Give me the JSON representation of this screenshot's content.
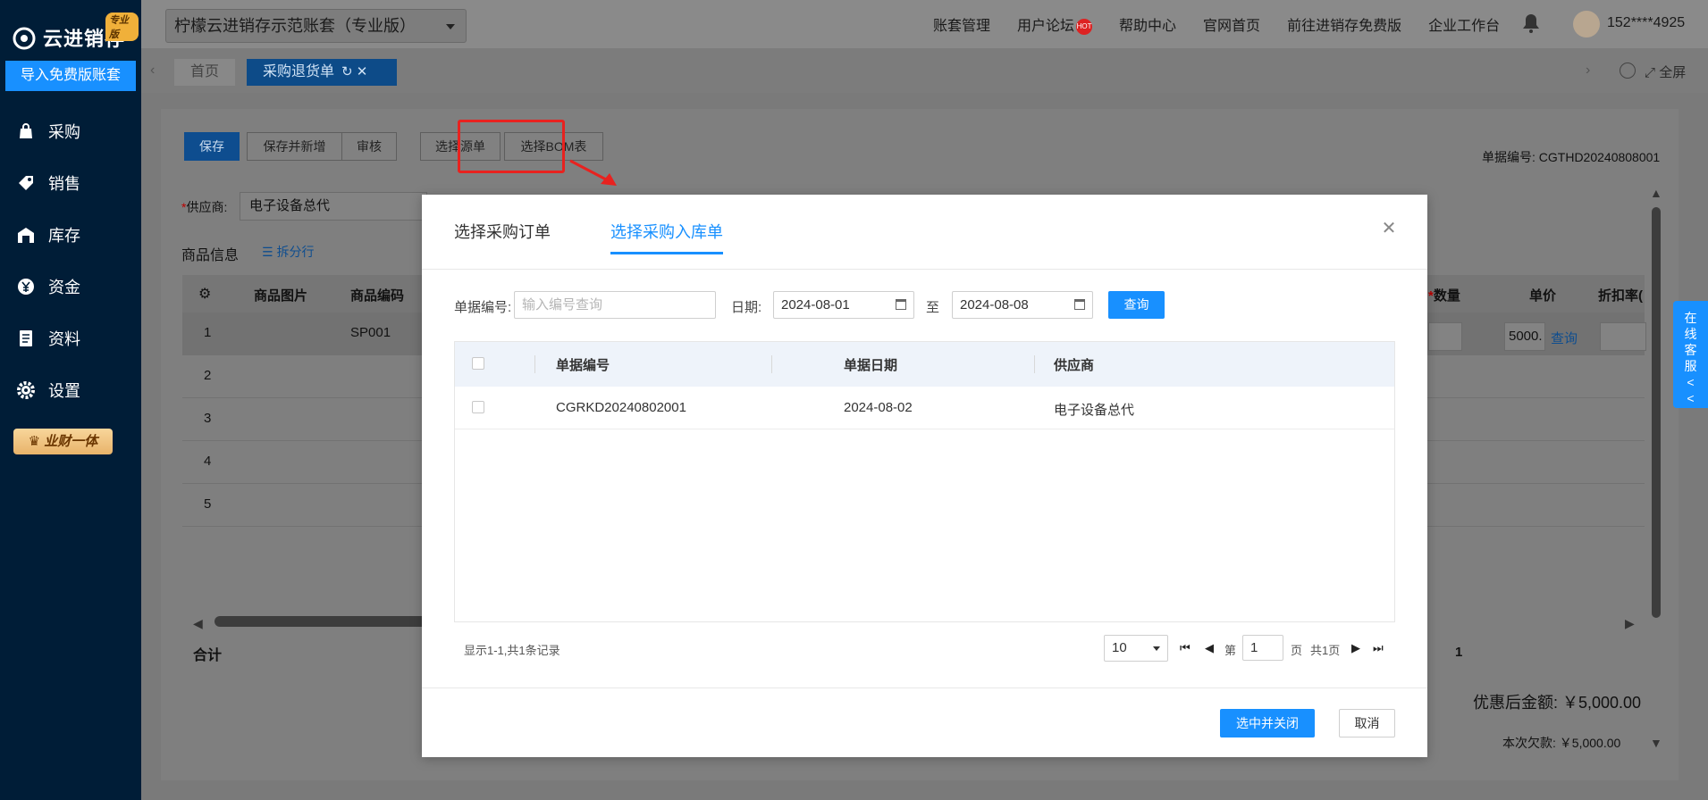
{
  "sidebar": {
    "logo_text": "云进销存",
    "logo_badge": "专业版",
    "import_button": "导入免费版账套",
    "items": [
      {
        "label": "采购",
        "icon": "bag-icon"
      },
      {
        "label": "销售",
        "icon": "sales-icon"
      },
      {
        "label": "库存",
        "icon": "warehouse-icon"
      },
      {
        "label": "资金",
        "icon": "yen-icon"
      },
      {
        "label": "资料",
        "icon": "document-icon"
      },
      {
        "label": "设置",
        "icon": "gear-icon"
      }
    ],
    "vip_badge": "业财一体"
  },
  "topbar": {
    "account": "柠檬云进销存示范账套（专业版）",
    "links": [
      "账套管理",
      "用户论坛",
      "帮助中心",
      "官网首页",
      "前往进销存免费版",
      "企业工作台"
    ],
    "hot_badge": "HOT",
    "user_phone": "152****4925"
  },
  "tabs": {
    "home": "首页",
    "active": "采购退货单",
    "fullscreen": "全屏"
  },
  "page": {
    "toolbar": [
      "保存",
      "保存并新增",
      "审核",
      "选择源单",
      "选择BOM表"
    ],
    "doc_no": "单据编号: CGTHD20240808001",
    "supplier_label": "供应商:",
    "supplier_value": "电子设备总代",
    "goods_title": "商品信息",
    "split_row": "拆分行",
    "grid_headers": [
      "商品图片",
      "商品编码"
    ],
    "grid_right_headers": [
      "数量",
      "单价",
      "折扣率("
    ],
    "rows": [
      {
        "no": "1",
        "code": "SP001",
        "price": "5000.",
        "query": "查询"
      },
      {
        "no": "2"
      },
      {
        "no": "3"
      },
      {
        "no": "4"
      },
      {
        "no": "5"
      }
    ],
    "total_label": "合计",
    "total_qty": "1",
    "discount_amount": "优惠后金额: ￥5,000.00",
    "owe_amount": "本次欠款: ￥5,000.00",
    "service_tab": "在线客服<<"
  },
  "modal": {
    "tabs": [
      "选择采购订单",
      "选择采购入库单"
    ],
    "active_tab": 1,
    "doc_no_label": "单据编号:",
    "doc_no_placeholder": "输入编号查询",
    "date_label": "日期:",
    "date_from": "2024-08-01",
    "date_to_sep": "至",
    "date_to": "2024-08-08",
    "query_button": "查询",
    "columns": [
      "单据编号",
      "单据日期",
      "供应商"
    ],
    "rows": [
      {
        "doc_no": "CGRKD20240802001",
        "date": "2024-08-02",
        "supplier": "电子设备总代"
      }
    ],
    "record_info": "显示1-1,共1条记录",
    "page_size": "10",
    "page_prefix": "第",
    "page_number": "1",
    "page_suffix": "页",
    "total_pages": "共1页",
    "ok_button": "选中并关闭",
    "cancel_button": "取消"
  }
}
